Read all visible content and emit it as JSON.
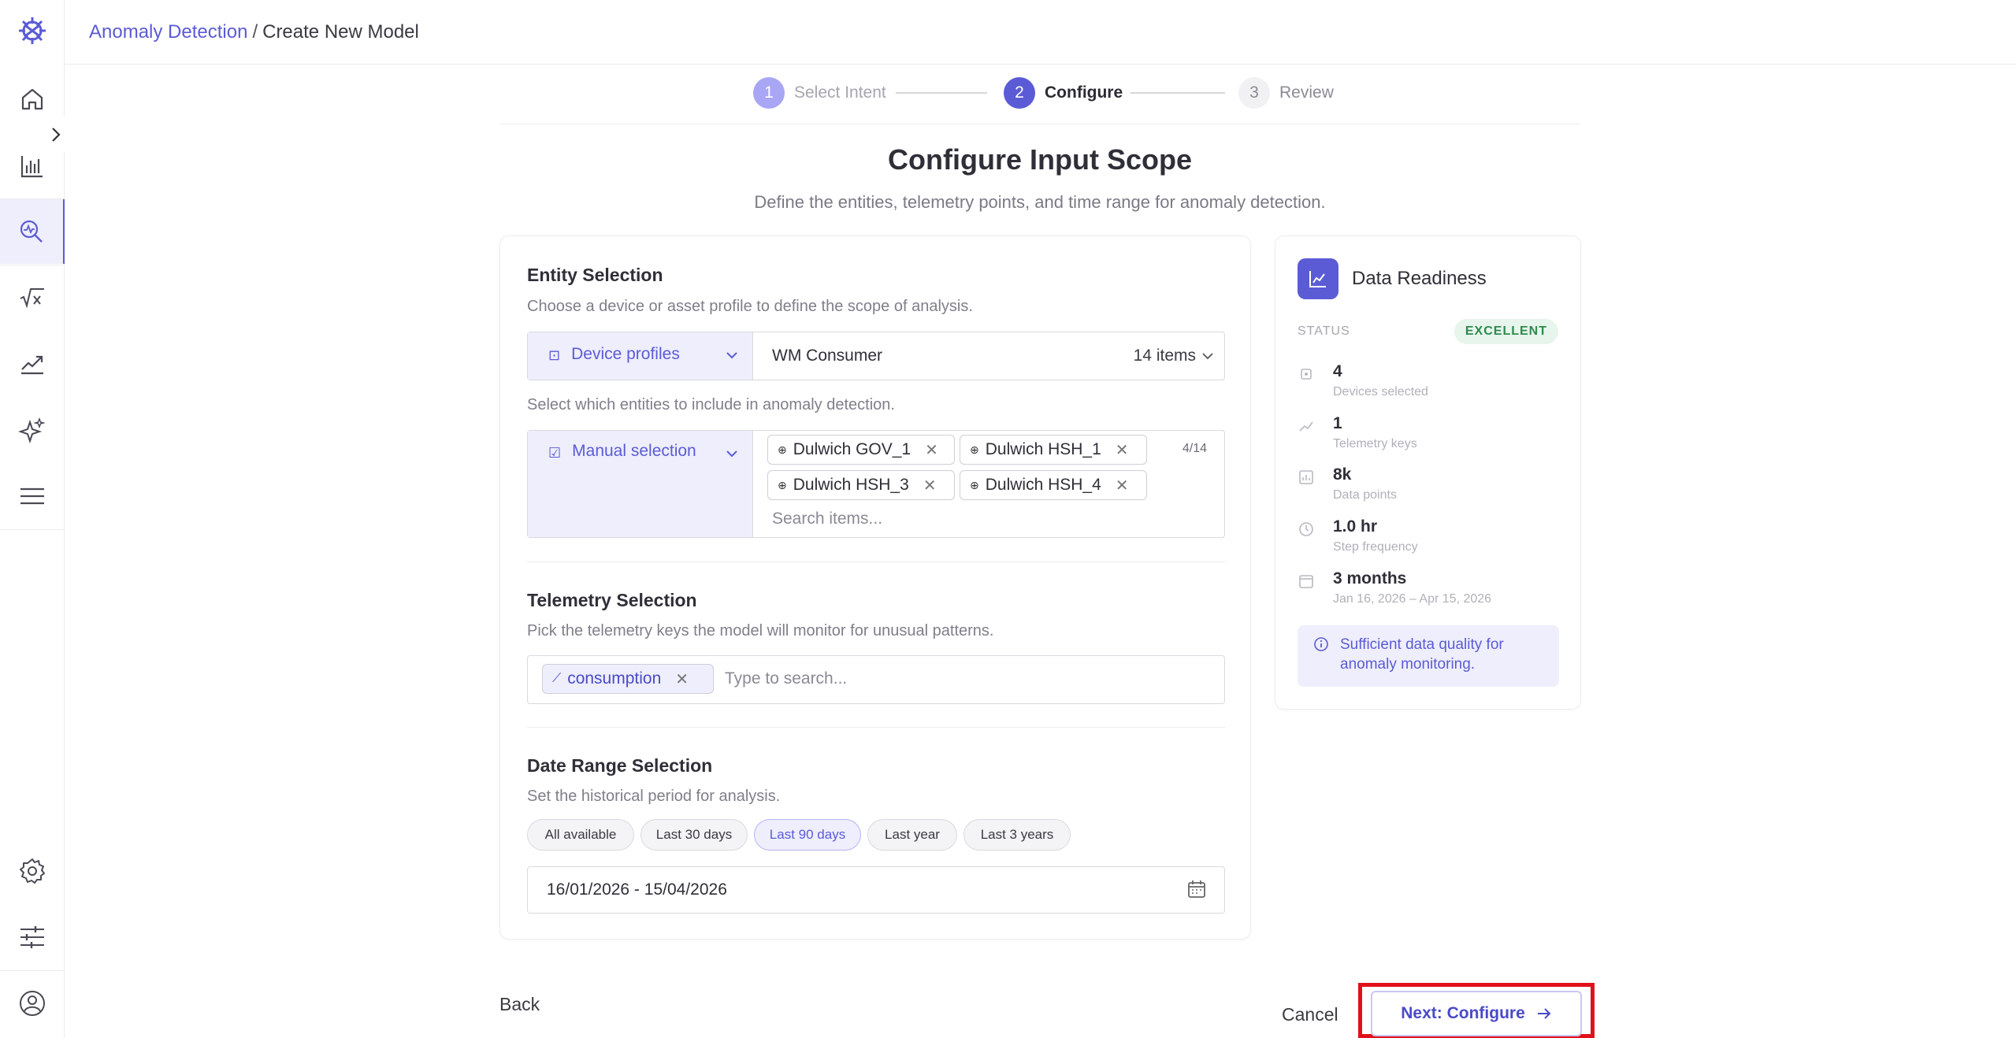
{
  "header": {
    "breadcrumb_link": "Anomaly Detection",
    "breadcrumb_sep": "/",
    "breadcrumb_current": "Create New Model"
  },
  "sidebar": {
    "items": [
      "home",
      "dashboards",
      "anomaly-detection",
      "formulas",
      "trends",
      "ai-insights",
      "menu",
      "settings",
      "preferences",
      "account"
    ],
    "active": "anomaly-detection"
  },
  "stepper": {
    "steps": [
      {
        "num": "1",
        "label": "Select Intent",
        "state": "done"
      },
      {
        "num": "2",
        "label": "Configure",
        "state": "current"
      },
      {
        "num": "3",
        "label": "Review",
        "state": "next"
      }
    ]
  },
  "page": {
    "title": "Configure Input Scope",
    "subtitle": "Define the entities, telemetry points, and time range for anomaly detection."
  },
  "entity": {
    "title": "Entity Selection",
    "desc": "Choose a device or asset profile to define the scope of analysis.",
    "profile_type": "Device profiles",
    "profile_value": "WM Consumer",
    "profile_count": "14 items",
    "entities_desc": "Select which entities to include in anomaly detection.",
    "selection_mode": "Manual selection",
    "selected_count": "4/14",
    "chips": [
      "Dulwich GOV_1",
      "Dulwich HSH_1",
      "Dulwich HSH_3",
      "Dulwich HSH_4"
    ],
    "search_placeholder": "Search items..."
  },
  "telemetry": {
    "title": "Telemetry Selection",
    "desc": "Pick the telemetry keys the model will monitor for unusual patterns.",
    "chip": "consumption",
    "search_placeholder": "Type to search..."
  },
  "date_range": {
    "title": "Date Range Selection",
    "desc": "Set the historical period for analysis.",
    "presets": [
      "All available",
      "Last 30 days",
      "Last 90 days",
      "Last year",
      "Last 3 years"
    ],
    "selected_preset": "Last 90 days",
    "value": "16/01/2026 - 15/04/2026"
  },
  "readiness": {
    "title": "Data Readiness",
    "status_label": "STATUS",
    "status_value": "EXCELLENT",
    "status_color": "#2f8a4d",
    "metrics": [
      {
        "value": "4",
        "label": "Devices selected",
        "icon": "device-icon"
      },
      {
        "value": "1",
        "label": "Telemetry keys",
        "icon": "trend-icon"
      },
      {
        "value": "8k",
        "label": "Data points",
        "icon": "chart-icon"
      },
      {
        "value": "1.0 hr",
        "label": "Step frequency",
        "icon": "clock-icon"
      },
      {
        "value": "3 months",
        "label": "Jan 16, 2026 – Apr 15, 2026",
        "icon": "calendar-icon"
      }
    ],
    "info": "Sufficient data quality for anomaly monitoring."
  },
  "footer": {
    "back": "Back",
    "cancel": "Cancel",
    "next": "Next: Configure"
  },
  "colors": {
    "accent": "#5b5bd6",
    "accent_light": "#eeeefc",
    "highlight": "#e1111b"
  }
}
